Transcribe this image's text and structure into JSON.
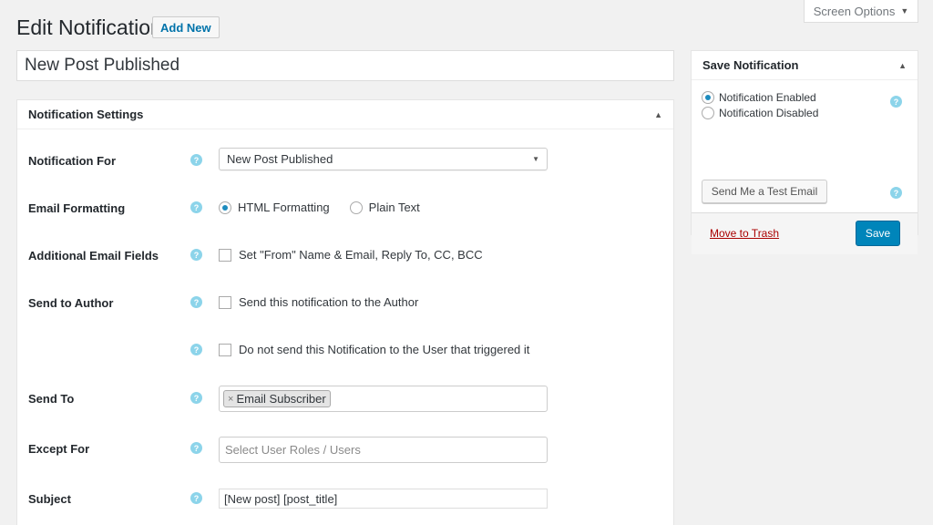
{
  "header": {
    "title": "Edit Notification",
    "add_new_label": "Add New",
    "screen_options_label": "Screen Options"
  },
  "post_title": "New Post Published",
  "settings_panel": {
    "title": "Notification Settings",
    "rows": {
      "notification_for": {
        "label": "Notification For",
        "value": "New Post Published"
      },
      "email_formatting": {
        "label": "Email Formatting",
        "option_html": "HTML Formatting",
        "option_plain": "Plain Text",
        "selected": "HTML Formatting"
      },
      "additional_fields": {
        "label": "Additional Email Fields",
        "checkbox_label": "Set \"From\" Name & Email, Reply To, CC, BCC"
      },
      "send_to_author": {
        "label": "Send to Author",
        "checkbox_label": "Send this notification to the Author"
      },
      "do_not_send": {
        "checkbox_label": "Do not send this Notification to the User that triggered it"
      },
      "send_to": {
        "label": "Send To",
        "token": "Email Subscriber",
        "token_remove": "×"
      },
      "except_for": {
        "label": "Except For",
        "placeholder": "Select User Roles / Users"
      },
      "subject": {
        "label": "Subject",
        "value": "[New post]  [post_title]"
      }
    }
  },
  "save_panel": {
    "title": "Save Notification",
    "option_enabled": "Notification Enabled",
    "option_disabled": "Notification Disabled",
    "selected": "Notification Enabled",
    "test_email_label": "Send Me a Test Email",
    "trash_label": "Move to Trash",
    "save_label": "Save"
  },
  "icons": {
    "help": "help-question-icon",
    "collapse": "collapse-arrow-icon",
    "dropdown": "dropdown-caret-icon"
  },
  "colors": {
    "accent": "#0085ba",
    "link": "#0073aa",
    "trash": "#aa0000",
    "help": "#8cd4ea"
  }
}
